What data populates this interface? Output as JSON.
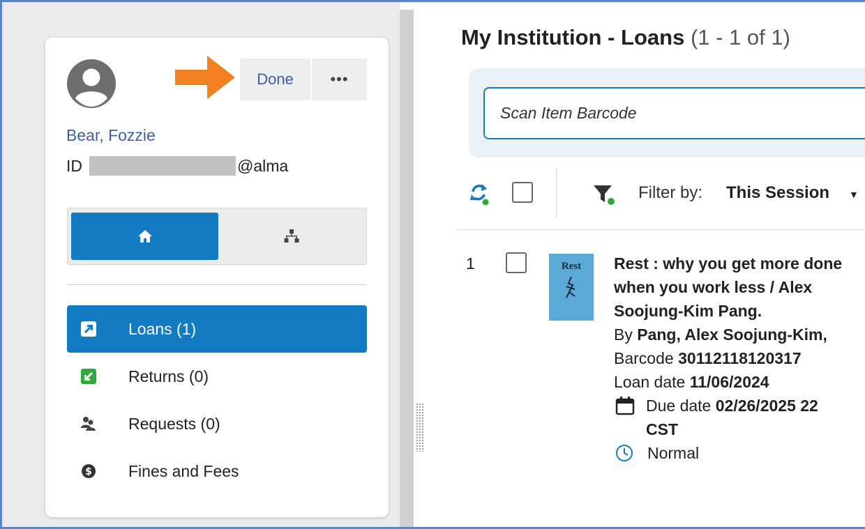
{
  "patron": {
    "name": "Bear, Fozzie",
    "id_prefix": "ID",
    "id_suffix": "@alma"
  },
  "header_buttons": {
    "done_label": "Done",
    "more_label": "•••"
  },
  "menu": {
    "items": [
      {
        "label": "Loans (1)",
        "icon": "loans-arrow-icon",
        "active": true
      },
      {
        "label": "Returns (0)",
        "icon": "returns-check-icon",
        "active": false
      },
      {
        "label": "Requests (0)",
        "icon": "requests-people-icon",
        "active": false
      },
      {
        "label": "Fines and Fees",
        "icon": "dollar-circle-icon",
        "active": false
      }
    ]
  },
  "main": {
    "title": "My Institution - Loans",
    "count": "(1 - 1 of 1)",
    "scan_placeholder": "Scan Item Barcode",
    "filter_label": "Filter by:",
    "filter_value": "This Session",
    "filter_caret": "▼"
  },
  "loans": [
    {
      "index": "1",
      "cover_text": "Rest",
      "title": "Rest : why you get more done when you work less / Alex Soojung-Kim Pang.",
      "by_label": "By",
      "author": "Pang, Alex Soojung-Kim,",
      "barcode_label": "Barcode",
      "barcode": "30112118120317",
      "loan_date_label": "Loan date",
      "loan_date": "11/06/2024",
      "due_date_label": "Due date",
      "due_date": "02/26/2025 22",
      "due_tz": "CST",
      "policy": "Normal"
    }
  ],
  "colors": {
    "accent_blue": "#127bc2",
    "link_blue": "#3a5ea8",
    "arrow_orange": "#f08020",
    "status_green": "#2eaa3d"
  }
}
